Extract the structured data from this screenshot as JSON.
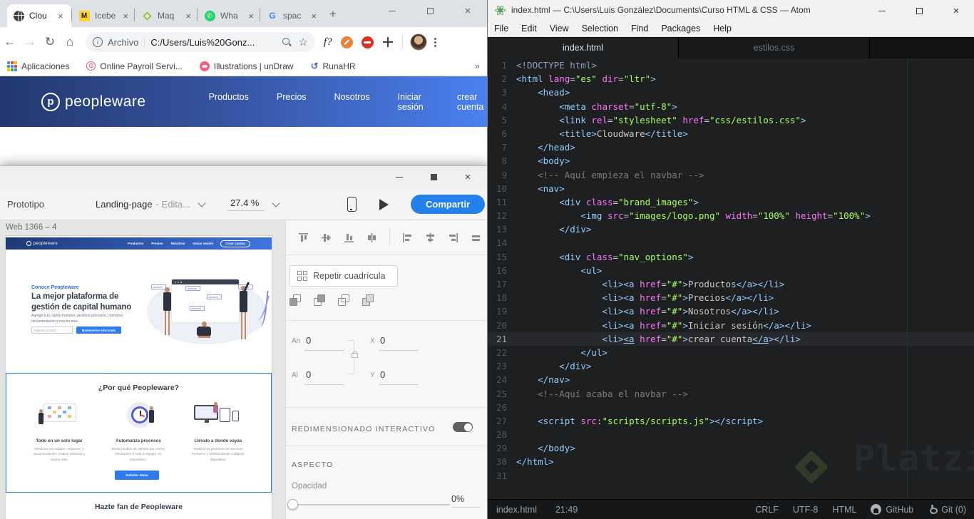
{
  "chrome": {
    "tabs": [
      {
        "title": "Clou",
        "icon": "globe"
      },
      {
        "title": "Icebe",
        "icon": "miro"
      },
      {
        "title": "Maq",
        "icon": "platzi"
      },
      {
        "title": "Wha",
        "icon": "whatsapp"
      },
      {
        "title": "spac",
        "icon": "google"
      }
    ],
    "close_glyph": "×",
    "new_tab_glyph": "+",
    "address": {
      "chip": "Archivo",
      "url": "C:/Users/Luis%20Gonz...",
      "star": "☆"
    },
    "nav_glyphs": {
      "back": "←",
      "forward": "→",
      "reload": "↻",
      "home": "⌂"
    },
    "ext_font_label": "f?",
    "bookmarks": {
      "apps": "Aplicaciones",
      "payroll": "Online Payroll Servi...",
      "undraw": "Illustrations | unDraw",
      "runa": "RunaHR",
      "runa_glyph": "↺",
      "more_glyph": "»",
      "g_letter": "G"
    },
    "page": {
      "brand": "peopleware",
      "logo_letter": "p",
      "nav": [
        "Productos",
        "Precios",
        "Nosotros",
        "Iniciar sesión",
        "crear cuenta"
      ]
    }
  },
  "xd": {
    "mode_label": "Prototipo",
    "doc_name": "Landing-page",
    "doc_status": "- Edita...",
    "zoom_value": "27.4 %",
    "share_label": "Compartir",
    "artboard_label": "Web 1366 – 4",
    "design": {
      "brand": "peopleware",
      "nav": [
        "Productos",
        "Precios",
        "Nosotros",
        "Iniciar sesión"
      ],
      "nav_cta": "Crear cuenta",
      "hero_eyebrow": "Conoce Peopleware",
      "hero_title": "La mejor plataforma de gestión de capital humano",
      "hero_sub": "Agrega a tu capital humano, gestiona procesos, contratos, documentación y mucho más.",
      "hero_input_placeholder": "Ingresa tu email",
      "hero_cta": "Mantenerme informado",
      "why_title": "¿Por qué Peopleware?",
      "features": [
        {
          "title": "Todo en un solo lugar",
          "text": "Gestiona a tu equipo, negocios, y documentación; analiza métricas y mucho más."
        },
        {
          "title": "Automatiza procesos",
          "text": "Envía recibos de nómina por correo electrónico a todo tu equipo, en automático."
        },
        {
          "title": "Llévalo a donde vayas",
          "text": "Realiza tus procesos de recursos humanos y nómina desde cualquier dispositivo."
        }
      ],
      "why_cta": "Solicitar demo",
      "fan_title": "Hazte fan de Peopleware"
    },
    "inspector": {
      "repeat_grid": "Repetir cuadrícula",
      "w_label": "An",
      "w_value": "0",
      "h_label": "Al",
      "h_value": "0",
      "x_label": "X",
      "x_value": "0",
      "y_label": "Y",
      "y_value": "0",
      "responsive_resize": "REDIMENSIONADO INTERACTIVO",
      "appearance": "ASPECTO",
      "opacity_label": "Opacidad",
      "opacity_value": "0%"
    }
  },
  "atom": {
    "title": "index.html — C:\\Users\\Luis González\\Documents\\Curso HTML & CSS — Atom",
    "menu": [
      "File",
      "Edit",
      "View",
      "Selection",
      "Find",
      "Packages",
      "Help"
    ],
    "tabs": [
      {
        "label": "index.html",
        "active": true
      },
      {
        "label": "estilos.css",
        "active": false
      }
    ],
    "status": {
      "file": "index.html",
      "cursor": "21:49",
      "line_ending": "CRLF",
      "encoding": "UTF-8",
      "grammar": "HTML",
      "github": "GitHub",
      "git": "Git (0)"
    },
    "watermark_text": "Platzi",
    "code": {
      "active_line": 21,
      "lines": [
        {
          "n": 1,
          "t": [
            [
              "cd",
              "<!DOCTYPE html>"
            ]
          ]
        },
        {
          "n": 2,
          "t": [
            [
              "ct",
              "<html"
            ],
            [
              "cx",
              " "
            ],
            [
              "ca",
              "lang"
            ],
            [
              "cx",
              "="
            ],
            [
              "cs",
              "\"es\""
            ],
            [
              "cx",
              " "
            ],
            [
              "ca",
              "dir"
            ],
            [
              "cx",
              "="
            ],
            [
              "cs",
              "\"ltr\""
            ],
            [
              "ct",
              ">"
            ]
          ]
        },
        {
          "n": 3,
          "t": [
            [
              "cx",
              "    "
            ],
            [
              "ct",
              "<head>"
            ]
          ]
        },
        {
          "n": 4,
          "t": [
            [
              "cx",
              "        "
            ],
            [
              "ct",
              "<meta"
            ],
            [
              "cx",
              " "
            ],
            [
              "ca",
              "charset"
            ],
            [
              "cx",
              "="
            ],
            [
              "cs",
              "\"utf-8\""
            ],
            [
              "ct",
              ">"
            ]
          ]
        },
        {
          "n": 5,
          "t": [
            [
              "cx",
              "        "
            ],
            [
              "ct",
              "<link"
            ],
            [
              "cx",
              " "
            ],
            [
              "ca",
              "rel"
            ],
            [
              "cx",
              "="
            ],
            [
              "cs",
              "\"stylesheet\""
            ],
            [
              "cx",
              " "
            ],
            [
              "ca",
              "href"
            ],
            [
              "cx",
              "="
            ],
            [
              "cs",
              "\"css/estilos.css\""
            ],
            [
              "ct",
              ">"
            ]
          ]
        },
        {
          "n": 6,
          "t": [
            [
              "cx",
              "        "
            ],
            [
              "ct",
              "<title>"
            ],
            [
              "cx",
              "Cloudware"
            ],
            [
              "ct",
              "</title>"
            ]
          ]
        },
        {
          "n": 7,
          "t": [
            [
              "cx",
              "    "
            ],
            [
              "ct",
              "</head>"
            ]
          ]
        },
        {
          "n": 8,
          "t": [
            [
              "cx",
              "    "
            ],
            [
              "ct",
              "<body>"
            ]
          ]
        },
        {
          "n": 9,
          "t": [
            [
              "cx",
              "    "
            ],
            [
              "cc",
              "<!-- Aquí empieza el navbar -->"
            ]
          ]
        },
        {
          "n": 10,
          "t": [
            [
              "cx",
              "    "
            ],
            [
              "ct",
              "<nav>"
            ]
          ]
        },
        {
          "n": 11,
          "t": [
            [
              "cx",
              "        "
            ],
            [
              "ct",
              "<div"
            ],
            [
              "cx",
              " "
            ],
            [
              "ca",
              "class"
            ],
            [
              "cx",
              "="
            ],
            [
              "cs",
              "\"brand_images\""
            ],
            [
              "ct",
              ">"
            ]
          ]
        },
        {
          "n": 12,
          "t": [
            [
              "cx",
              "            "
            ],
            [
              "ct",
              "<img"
            ],
            [
              "cx",
              " "
            ],
            [
              "ca",
              "src"
            ],
            [
              "cx",
              "="
            ],
            [
              "cs",
              "\"images/logo.png\""
            ],
            [
              "cx",
              " "
            ],
            [
              "ca",
              "width"
            ],
            [
              "cx",
              "="
            ],
            [
              "cs",
              "\"100%\""
            ],
            [
              "cx",
              " "
            ],
            [
              "ca",
              "height"
            ],
            [
              "cx",
              "="
            ],
            [
              "cs",
              "\"100%\""
            ],
            [
              "ct",
              ">"
            ]
          ]
        },
        {
          "n": 13,
          "t": [
            [
              "cx",
              "        "
            ],
            [
              "ct",
              "</div>"
            ]
          ]
        },
        {
          "n": 14,
          "t": []
        },
        {
          "n": 15,
          "t": [
            [
              "cx",
              "        "
            ],
            [
              "ct",
              "<div"
            ],
            [
              "cx",
              " "
            ],
            [
              "ca",
              "class"
            ],
            [
              "cx",
              "="
            ],
            [
              "cs",
              "\"nav_options\""
            ],
            [
              "ct",
              ">"
            ]
          ]
        },
        {
          "n": 16,
          "t": [
            [
              "cx",
              "            "
            ],
            [
              "ct",
              "<ul>"
            ]
          ]
        },
        {
          "n": 17,
          "t": [
            [
              "cx",
              "                "
            ],
            [
              "ct",
              "<li><a"
            ],
            [
              "cx",
              " "
            ],
            [
              "ca",
              "href"
            ],
            [
              "cx",
              "="
            ],
            [
              "cs",
              "\"#\""
            ],
            [
              "ct",
              ">"
            ],
            [
              "cx",
              "Productos"
            ],
            [
              "ct",
              "</a></li>"
            ]
          ]
        },
        {
          "n": 18,
          "t": [
            [
              "cx",
              "                "
            ],
            [
              "ct",
              "<li><a"
            ],
            [
              "cx",
              " "
            ],
            [
              "ca",
              "href"
            ],
            [
              "cx",
              "="
            ],
            [
              "cs",
              "\"#\""
            ],
            [
              "ct",
              ">"
            ],
            [
              "cx",
              "Precios"
            ],
            [
              "ct",
              "</a></li>"
            ]
          ]
        },
        {
          "n": 19,
          "t": [
            [
              "cx",
              "                "
            ],
            [
              "ct",
              "<li><a"
            ],
            [
              "cx",
              " "
            ],
            [
              "ca",
              "href"
            ],
            [
              "cx",
              "="
            ],
            [
              "cs",
              "\"#\""
            ],
            [
              "ct",
              ">"
            ],
            [
              "cx",
              "Nosotros"
            ],
            [
              "ct",
              "</a></li>"
            ]
          ]
        },
        {
          "n": 20,
          "t": [
            [
              "cx",
              "                "
            ],
            [
              "ct",
              "<li><a"
            ],
            [
              "cx",
              " "
            ],
            [
              "ca",
              "href"
            ],
            [
              "cx",
              "="
            ],
            [
              "cs",
              "\"#\""
            ],
            [
              "ct",
              ">"
            ],
            [
              "cx",
              "Iniciar sesión"
            ],
            [
              "ct",
              "</a></li>"
            ]
          ]
        },
        {
          "n": 21,
          "t": [
            [
              "cx",
              "                "
            ],
            [
              "ct",
              "<li>"
            ],
            [
              "cu",
              "<a"
            ],
            [
              "cx",
              " "
            ],
            [
              "ca",
              "href"
            ],
            [
              "cx",
              "="
            ],
            [
              "cs",
              "\"#\""
            ],
            [
              "ct",
              ">"
            ],
            [
              "cx",
              "crear cuenta"
            ],
            [
              "cu",
              "</a"
            ],
            [
              "ct",
              "></li>"
            ]
          ]
        },
        {
          "n": 22,
          "t": [
            [
              "cx",
              "            "
            ],
            [
              "ct",
              "</ul>"
            ]
          ]
        },
        {
          "n": 23,
          "t": [
            [
              "cx",
              "        "
            ],
            [
              "ct",
              "</div>"
            ]
          ]
        },
        {
          "n": 24,
          "t": [
            [
              "cx",
              "    "
            ],
            [
              "ct",
              "</nav>"
            ]
          ]
        },
        {
          "n": 25,
          "t": [
            [
              "cx",
              "    "
            ],
            [
              "cc",
              "<!--Aquí acaba el navbar -->"
            ]
          ]
        },
        {
          "n": 26,
          "t": []
        },
        {
          "n": 27,
          "t": [
            [
              "cx",
              "    "
            ],
            [
              "ct",
              "<script"
            ],
            [
              "cx",
              " "
            ],
            [
              "ca",
              "src"
            ],
            [
              "cx",
              ":"
            ],
            [
              "cs",
              "\"scripts/scripts.js\""
            ],
            [
              "ct",
              "></script>"
            ]
          ]
        },
        {
          "n": 28,
          "t": []
        },
        {
          "n": 29,
          "t": [
            [
              "cx",
              "    "
            ],
            [
              "ct",
              "</body>"
            ]
          ]
        },
        {
          "n": 30,
          "t": [
            [
              "ct",
              "</html>"
            ]
          ]
        },
        {
          "n": 31,
          "t": []
        }
      ]
    }
  },
  "colors": {
    "site_nav_gradient_start": "#22386e",
    "site_nav_gradient_end": "#4a80f0",
    "xd_accent": "#2680eb",
    "atom_bg": "#1d1f21",
    "code_tag": "#96cbfe",
    "code_attr": "#ff73fd",
    "code_string": "#a8ff60",
    "code_comment": "#7c7c7c",
    "platzi_green": "#98ca3f"
  }
}
